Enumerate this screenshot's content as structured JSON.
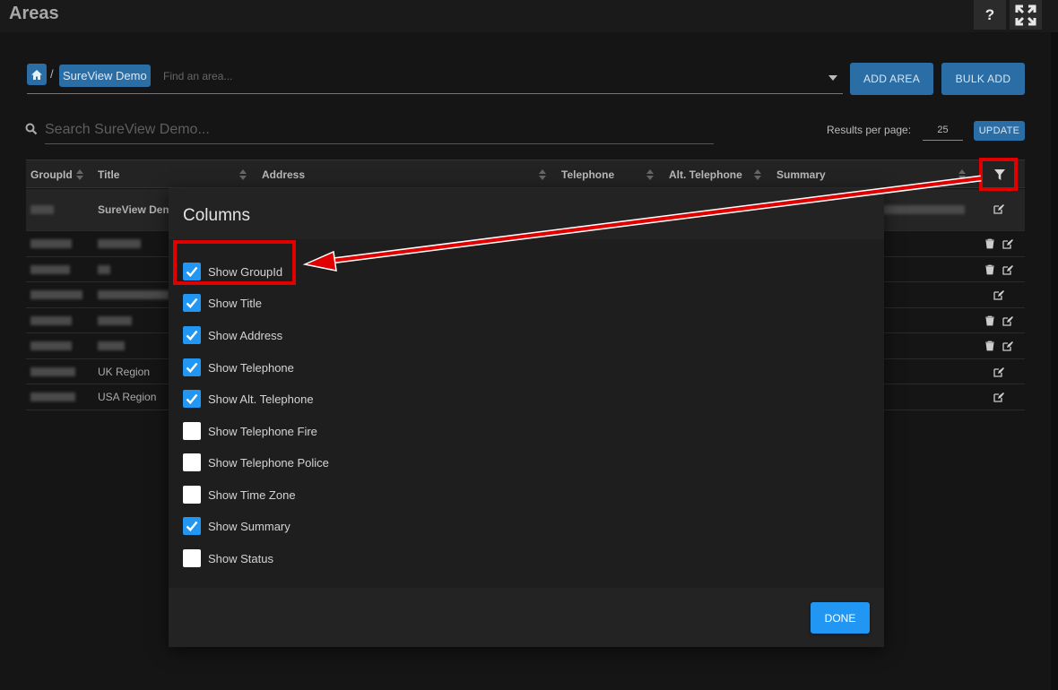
{
  "page": {
    "title": "Areas"
  },
  "topbar": {
    "help_label": "?"
  },
  "breadcrumb": {
    "separator": "/",
    "current": "SureView Demo"
  },
  "area_search": {
    "placeholder": "Find an area..."
  },
  "actions": {
    "add_area": "ADD AREA",
    "bulk_add": "BULK ADD"
  },
  "search": {
    "placeholder": "Search SureView Demo..."
  },
  "paging": {
    "label": "Results per page:",
    "value": "25",
    "update_label": "UPDATE"
  },
  "table": {
    "columns": [
      "GroupId",
      "Title",
      "Address",
      "Telephone",
      "Alt. Telephone",
      "Summary"
    ],
    "rows": [
      {
        "title": "SureView Dem"
      },
      {
        "title": ""
      },
      {
        "title": ""
      },
      {
        "title": ""
      },
      {
        "title": ""
      },
      {
        "title": ""
      },
      {
        "title": "UK Region"
      },
      {
        "title": "USA Region"
      }
    ]
  },
  "modal": {
    "title": "Columns",
    "options": [
      {
        "label": "Show GroupId",
        "checked": true
      },
      {
        "label": "Show Title",
        "checked": true
      },
      {
        "label": "Show Address",
        "checked": true
      },
      {
        "label": "Show Telephone",
        "checked": true
      },
      {
        "label": "Show Alt. Telephone",
        "checked": true
      },
      {
        "label": "Show Telephone Fire",
        "checked": false
      },
      {
        "label": "Show Telephone Police",
        "checked": false
      },
      {
        "label": "Show Time Zone",
        "checked": false
      },
      {
        "label": "Show Summary",
        "checked": true
      },
      {
        "label": "Show Status",
        "checked": false
      }
    ],
    "done_label": "DONE"
  },
  "colors": {
    "accent": "#2196f3",
    "primary_button": "#2b6ea6",
    "annotation": "#e00000",
    "background": "#151515"
  }
}
